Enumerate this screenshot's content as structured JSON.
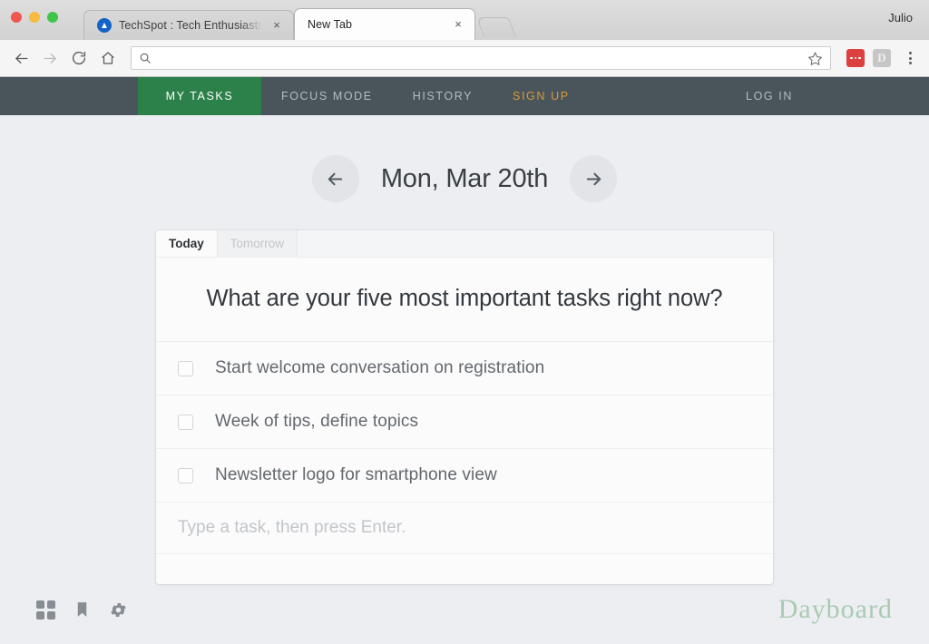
{
  "browser": {
    "profile_name": "Julio",
    "tabs": [
      {
        "title": "TechSpot : Tech Enthusiasts, F",
        "favicon": "techspot-circle-icon",
        "active": false,
        "close_label": "×"
      },
      {
        "title": "New Tab",
        "favicon": "none",
        "active": true,
        "close_label": "×"
      }
    ],
    "toolbar": {
      "back_icon": "back-arrow-icon",
      "forward_icon": "forward-arrow-icon",
      "reload_icon": "reload-icon",
      "home_icon": "home-icon",
      "search_icon": "search-icon",
      "omnibox_value": "",
      "omnibox_placeholder": "",
      "bookmark_icon": "star-icon",
      "extension_red_label": "lastpass-extension-icon",
      "extension_gray_label": "D",
      "menu_icon": "three-dot-menu-icon"
    },
    "window_controls": {
      "close": "close-window-button",
      "minimize": "minimize-window-button",
      "zoom": "zoom-window-button"
    }
  },
  "site": {
    "nav": [
      {
        "label": "MY TASKS",
        "state": "active"
      },
      {
        "label": "FOCUS MODE",
        "state": "default"
      },
      {
        "label": "HISTORY",
        "state": "default"
      },
      {
        "label": "SIGN UP",
        "state": "highlight"
      },
      {
        "label": "LOG IN",
        "state": "default"
      }
    ],
    "nav_colors": {
      "bar_background": "#4a555b",
      "active_background": "#2c8049",
      "signup_text": "#d79a3c",
      "default_text": "#b4bcc0"
    },
    "date_header": {
      "prev_icon": "arrow-left-icon",
      "date": "Mon, Mar 20th",
      "next_icon": "arrow-right-icon"
    },
    "card": {
      "tabs": [
        {
          "label": "Today",
          "active": true
        },
        {
          "label": "Tomorrow",
          "active": false
        }
      ],
      "question": "What are your five most important tasks right now?",
      "tasks": [
        {
          "label": "Start welcome conversation on registration",
          "checked": false
        },
        {
          "label": "Week of tips, define topics",
          "checked": false
        },
        {
          "label": "Newsletter logo for smartphone view",
          "checked": false
        }
      ],
      "new_task_value": "",
      "new_task_placeholder": "Type a task, then press Enter."
    },
    "footer": {
      "icons": [
        {
          "name": "grid-icon"
        },
        {
          "name": "bookmark-icon"
        },
        {
          "name": "gear-icon"
        }
      ],
      "brand": "Dayboard",
      "brand_color": "#a9cbb2"
    },
    "page_background": "#eceef1"
  }
}
